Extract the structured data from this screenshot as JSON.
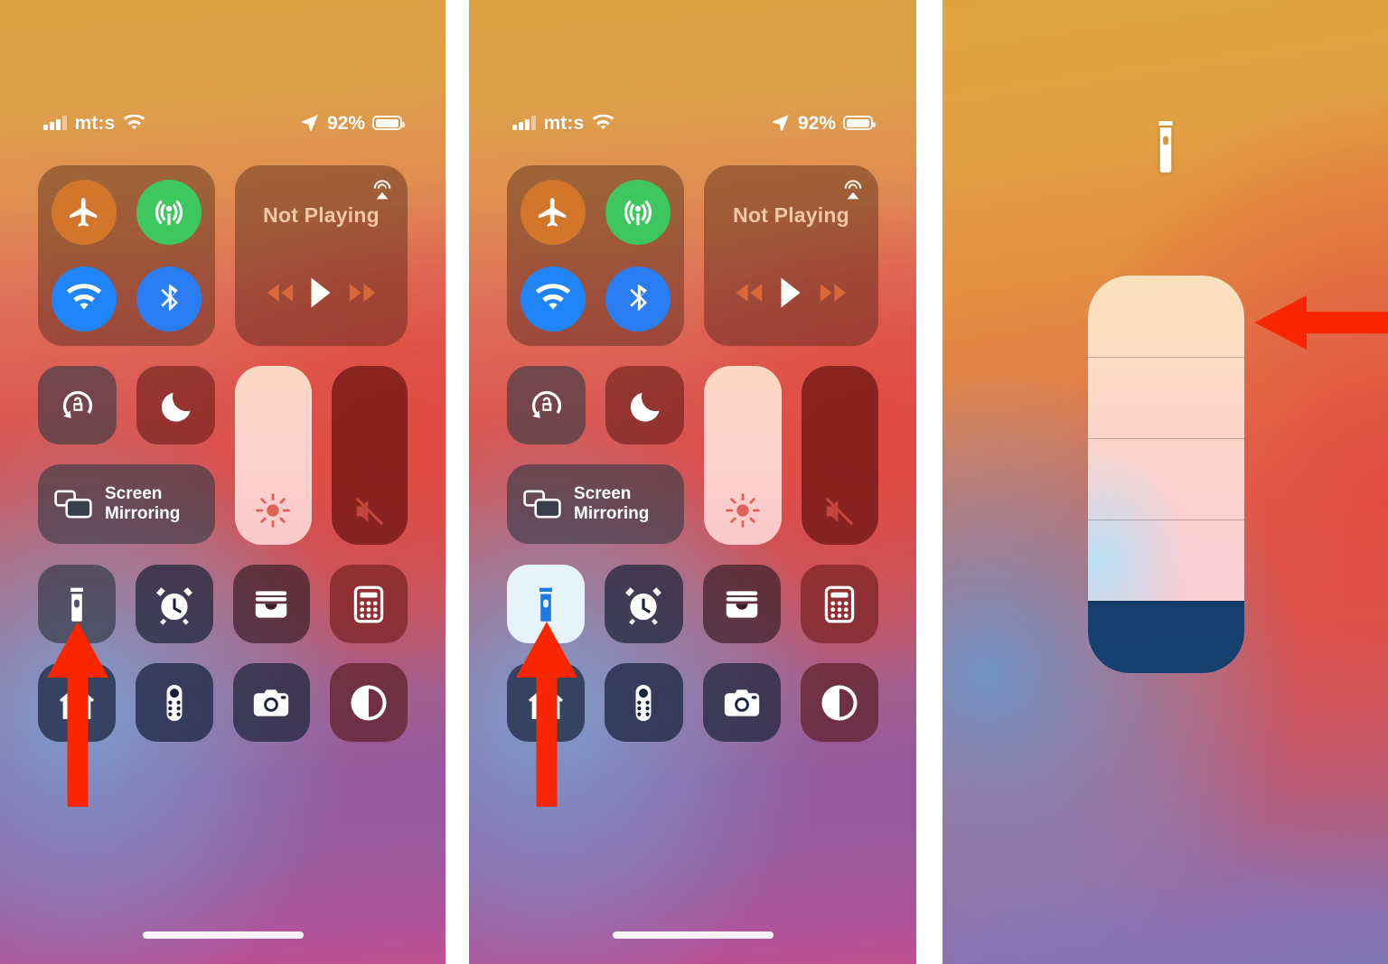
{
  "status_bar": {
    "carrier": "mt:s",
    "battery_percent": "92%",
    "signal_icon": "cellular-bars-icon",
    "wifi_icon": "wifi-icon",
    "location_icon": "location-arrow-icon",
    "battery_icon": "battery-icon"
  },
  "connectivity": {
    "airplane": {
      "name": "airplane-mode",
      "icon": "airplane-icon",
      "state": "on",
      "color": "#d2762c"
    },
    "cellular": {
      "name": "cellular-data",
      "icon": "cellular-antenna-icon",
      "state": "on",
      "color": "#3ec75f"
    },
    "wifi": {
      "name": "wifi",
      "icon": "wifi-icon",
      "state": "on",
      "color": "#1f85f8"
    },
    "bluetooth": {
      "name": "bluetooth",
      "icon": "bluetooth-icon",
      "state": "on",
      "color": "#2b7df3"
    }
  },
  "media": {
    "title": "Not Playing",
    "airplay_icon": "airplay-audio-icon",
    "rewind_icon": "rewind-icon",
    "play_icon": "play-icon",
    "forward_icon": "fast-forward-icon"
  },
  "toggles": {
    "rotation_lock": {
      "icon": "rotation-lock-icon",
      "state": "off"
    },
    "do_not_disturb": {
      "icon": "moon-icon",
      "state": "off"
    },
    "screen_mirroring": {
      "label_line1": "Screen",
      "label_line2": "Mirroring",
      "icon": "screen-mirroring-icon"
    }
  },
  "sliders": {
    "brightness": {
      "icon": "brightness-sun-icon",
      "level_percent": 100
    },
    "volume": {
      "icon": "speaker-muted-icon",
      "level_percent": 0,
      "muted": true
    }
  },
  "apps_row_1": [
    {
      "name": "flashlight",
      "icon": "flashlight-icon",
      "state": "off"
    },
    {
      "name": "alarm",
      "icon": "alarm-clock-icon",
      "state": "off"
    },
    {
      "name": "wallet",
      "icon": "wallet-icon",
      "state": "off"
    },
    {
      "name": "calculator",
      "icon": "calculator-icon",
      "state": "off"
    }
  ],
  "apps_row_2": [
    {
      "name": "home",
      "icon": "home-house-icon",
      "state": "off"
    },
    {
      "name": "apple-tv-remote",
      "icon": "tv-remote-icon",
      "state": "off"
    },
    {
      "name": "camera",
      "icon": "camera-icon",
      "state": "off"
    },
    {
      "name": "dark-mode",
      "icon": "dark-mode-circle-icon",
      "state": "off"
    }
  ],
  "panels": [
    {
      "id": "panel-1",
      "caption_state": "flashlight-off",
      "annotation": "red-arrow-up-to-flashlight"
    },
    {
      "id": "panel-2",
      "caption_state": "flashlight-on",
      "annotation": "red-arrow-up-to-flashlight"
    },
    {
      "id": "panel-3",
      "caption_state": "flashlight-brightness-slider",
      "annotation": "red-arrow-left-to-slider-top"
    }
  ],
  "panel_3": {
    "torch_icon": "flashlight-icon",
    "brightness_slider": {
      "name": "flashlight-brightness-slider",
      "levels_total": 4,
      "level_selected": 4,
      "fill_percent": 82
    }
  },
  "annotations": {
    "arrow_color": "#fa2600",
    "arrow_1": "up-arrow-pointing-at-flashlight-tile",
    "arrow_2": "up-arrow-pointing-at-flashlight-tile",
    "arrow_3": "left-arrow-pointing-at-slider-top-segment"
  },
  "home_indicator": {
    "name": "home-indicator"
  }
}
